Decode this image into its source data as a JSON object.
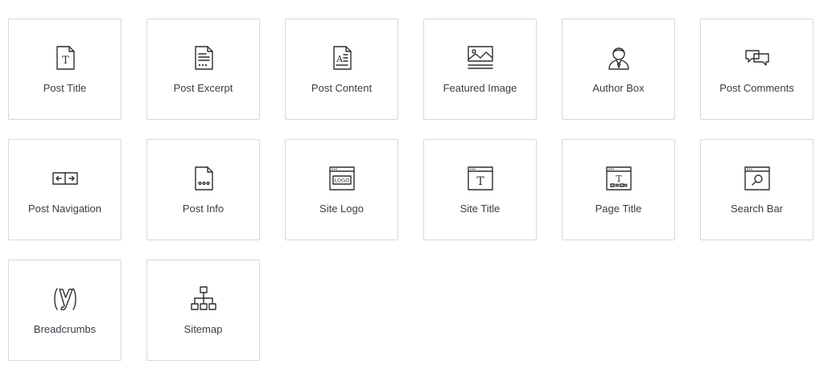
{
  "widgets": [
    {
      "label": "Post Title",
      "icon": "post-title-icon"
    },
    {
      "label": "Post Excerpt",
      "icon": "post-excerpt-icon"
    },
    {
      "label": "Post Content",
      "icon": "post-content-icon"
    },
    {
      "label": "Featured Image",
      "icon": "featured-image-icon"
    },
    {
      "label": "Author Box",
      "icon": "author-box-icon"
    },
    {
      "label": "Post Comments",
      "icon": "post-comments-icon"
    },
    {
      "label": "Post Navigation",
      "icon": "post-navigation-icon"
    },
    {
      "label": "Post Info",
      "icon": "post-info-icon"
    },
    {
      "label": "Site Logo",
      "icon": "site-logo-icon",
      "icon_text": "LOGO"
    },
    {
      "label": "Site Title",
      "icon": "site-title-icon",
      "icon_text": "T"
    },
    {
      "label": "Page Title",
      "icon": "page-title-icon",
      "icon_text": "T"
    },
    {
      "label": "Search Bar",
      "icon": "search-bar-icon"
    },
    {
      "label": "Breadcrumbs",
      "icon": "breadcrumbs-icon"
    },
    {
      "label": "Sitemap",
      "icon": "sitemap-icon"
    }
  ],
  "icon_doc_letter": "T",
  "icon_content_letter": "A",
  "colors": {
    "border": "#d5d8dc",
    "icon": "#2d2f35",
    "text": "#3a3d45",
    "background": "#ffffff"
  }
}
